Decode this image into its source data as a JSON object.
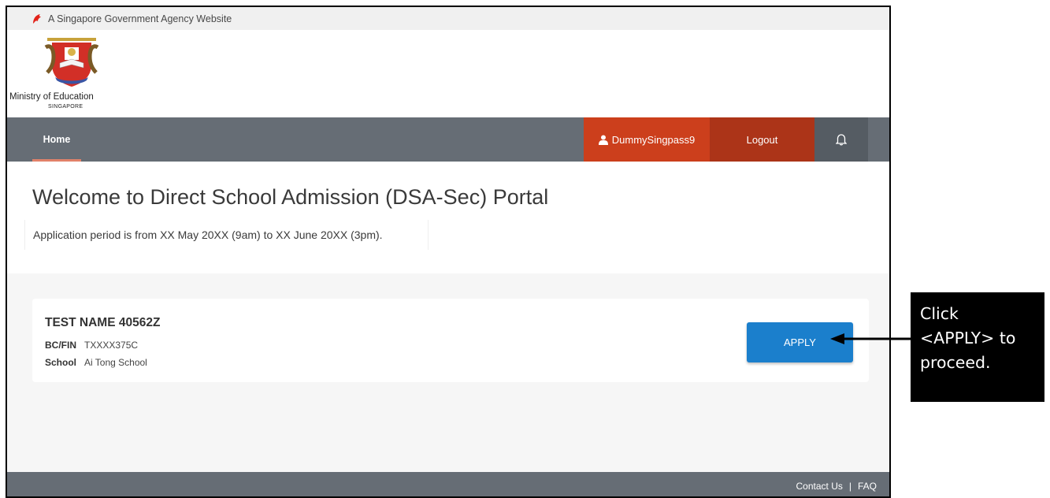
{
  "gov_banner": {
    "text": "A Singapore Government Agency Website",
    "icon": "lion-head-icon"
  },
  "brand": {
    "name": "Ministry of Education",
    "sub": "SINGAPORE",
    "logo": "moe-crest"
  },
  "nav": {
    "home": "Home",
    "user": "DummySingpass9",
    "logout": "Logout",
    "bell_icon": "bell-icon",
    "colors": {
      "bar": "#666d75",
      "user": "#cc3f1c",
      "logout": "#ac3418",
      "active_underline": "#e2826a"
    }
  },
  "welcome": {
    "title": "Welcome to Direct School Admission (DSA-Sec) Portal",
    "period": "Application period is from XX May 20XX (9am) to XX June 20XX (3pm)."
  },
  "student": {
    "name": "TEST NAME 40562Z",
    "bcfin_label": "BC/FIN",
    "bcfin_value": "TXXXX375C",
    "school_label": "School",
    "school_value": "Ai Tong School"
  },
  "apply_button": {
    "label": "APPLY",
    "color": "#1b7fcc"
  },
  "footer": {
    "contact": "Contact Us",
    "separator": "|",
    "faq": "FAQ"
  },
  "callout": {
    "lines": [
      "Click",
      "<APPLY> to",
      "proceed."
    ]
  }
}
